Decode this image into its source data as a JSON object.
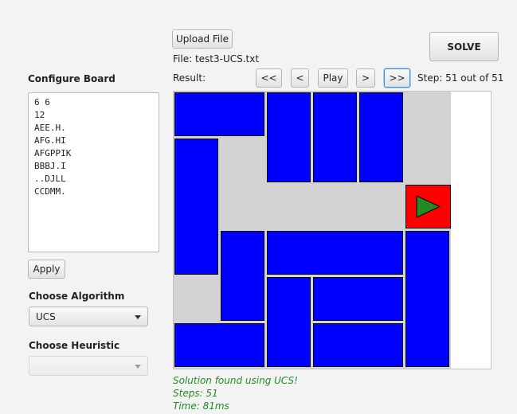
{
  "upload_button": "Upload File",
  "file_label": "File: test3-UCS.txt",
  "solve_button": "SOLVE",
  "result_label": "Result:",
  "nav": {
    "first": "<<",
    "prev": "<",
    "play": "Play",
    "next": ">",
    "last": ">>"
  },
  "step_label": "Step: 51 out of 51",
  "configure_label": "Configure Board",
  "board_config_lines": [
    "6 6",
    "12",
    "AEE.H.",
    "AFG.HI",
    "AFGPPIK",
    "BBBJ.I",
    "..DJLL",
    "CCDMM."
  ],
  "apply_button": "Apply",
  "algorithm_label": "Choose Algorithm",
  "algorithm_selected": "UCS",
  "heuristic_label": "Choose Heuristic",
  "heuristic_selected": "",
  "status": {
    "line1": "Solution found using UCS!",
    "line2": "Steps: 51",
    "line3": "Time: 81ms"
  },
  "colors": {
    "piece": "#0000ff",
    "primary_piece": "#ff0000",
    "exit_arrow": "#228b22",
    "grid": "#d3d3d3",
    "status_text": "#228b22"
  }
}
